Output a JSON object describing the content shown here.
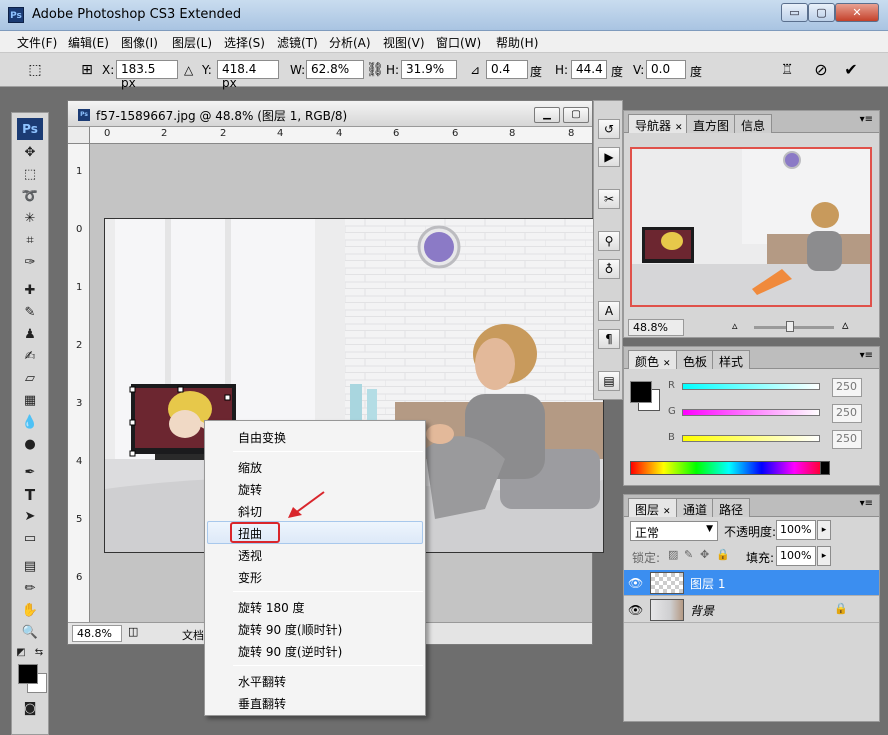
{
  "window": {
    "title": "Adobe Photoshop CS3 Extended",
    "logo": "Ps",
    "min": "▭",
    "max": "▢",
    "close": "✕"
  },
  "menu": [
    "文件(F)",
    "编辑(E)",
    "图像(I)",
    "图层(L)",
    "选择(S)",
    "滤镜(T)",
    "分析(A)",
    "视图(V)",
    "窗口(W)",
    "帮助(H)"
  ],
  "options": {
    "x_label": "X:",
    "x_value": "183.5 px",
    "y_label": "Y:",
    "y_value": "418.4 px",
    "w_label": "W:",
    "w_value": "62.8%",
    "h_label": "H:",
    "h_value": "31.9%",
    "angle_value": "0.4",
    "angle_unit": "度",
    "hskew_label": "H:",
    "hskew_value": "44.4",
    "hskew_unit": "度",
    "vskew_label": "V:",
    "vskew_value": "0.0",
    "vskew_unit": "度"
  },
  "toolbox": {
    "logo": "Ps"
  },
  "document": {
    "title": "f57-1589667.jpg @ 48.8% (图层 1, RGB/8)",
    "zoom": "48.8%",
    "status": "文档",
    "ruler_h": [
      "0",
      "2",
      "4",
      "6",
      "8"
    ],
    "ruler_v": [
      "1",
      "0",
      "1",
      "2",
      "3",
      "4",
      "5",
      "6"
    ]
  },
  "context_menu": {
    "items": [
      "自由变换",
      "缩放",
      "旋转",
      "斜切",
      "扭曲",
      "透视",
      "变形",
      "旋转 180 度",
      "旋转 90 度(顺时针)",
      "旋转 90 度(逆时针)",
      "水平翻转",
      "垂直翻转"
    ],
    "highlight_color": "#d9262c"
  },
  "navigator": {
    "tabs": [
      "导航器",
      "直方图",
      "信息"
    ],
    "zoom": "48.8%"
  },
  "color": {
    "tabs": [
      "颜色",
      "色板",
      "样式"
    ],
    "r_label": "R",
    "r": "250",
    "g_label": "G",
    "g": "250",
    "b_label": "B",
    "b": "250"
  },
  "layers": {
    "tabs": [
      "图层",
      "通道",
      "路径"
    ],
    "blend_mode": "正常",
    "opacity_label": "不透明度:",
    "opacity": "100%",
    "lock_label": "锁定:",
    "fill_label": "填充:",
    "fill": "100%",
    "items": [
      {
        "name": "图层 1",
        "selected": true
      },
      {
        "name": "背景",
        "selected": false
      }
    ]
  }
}
